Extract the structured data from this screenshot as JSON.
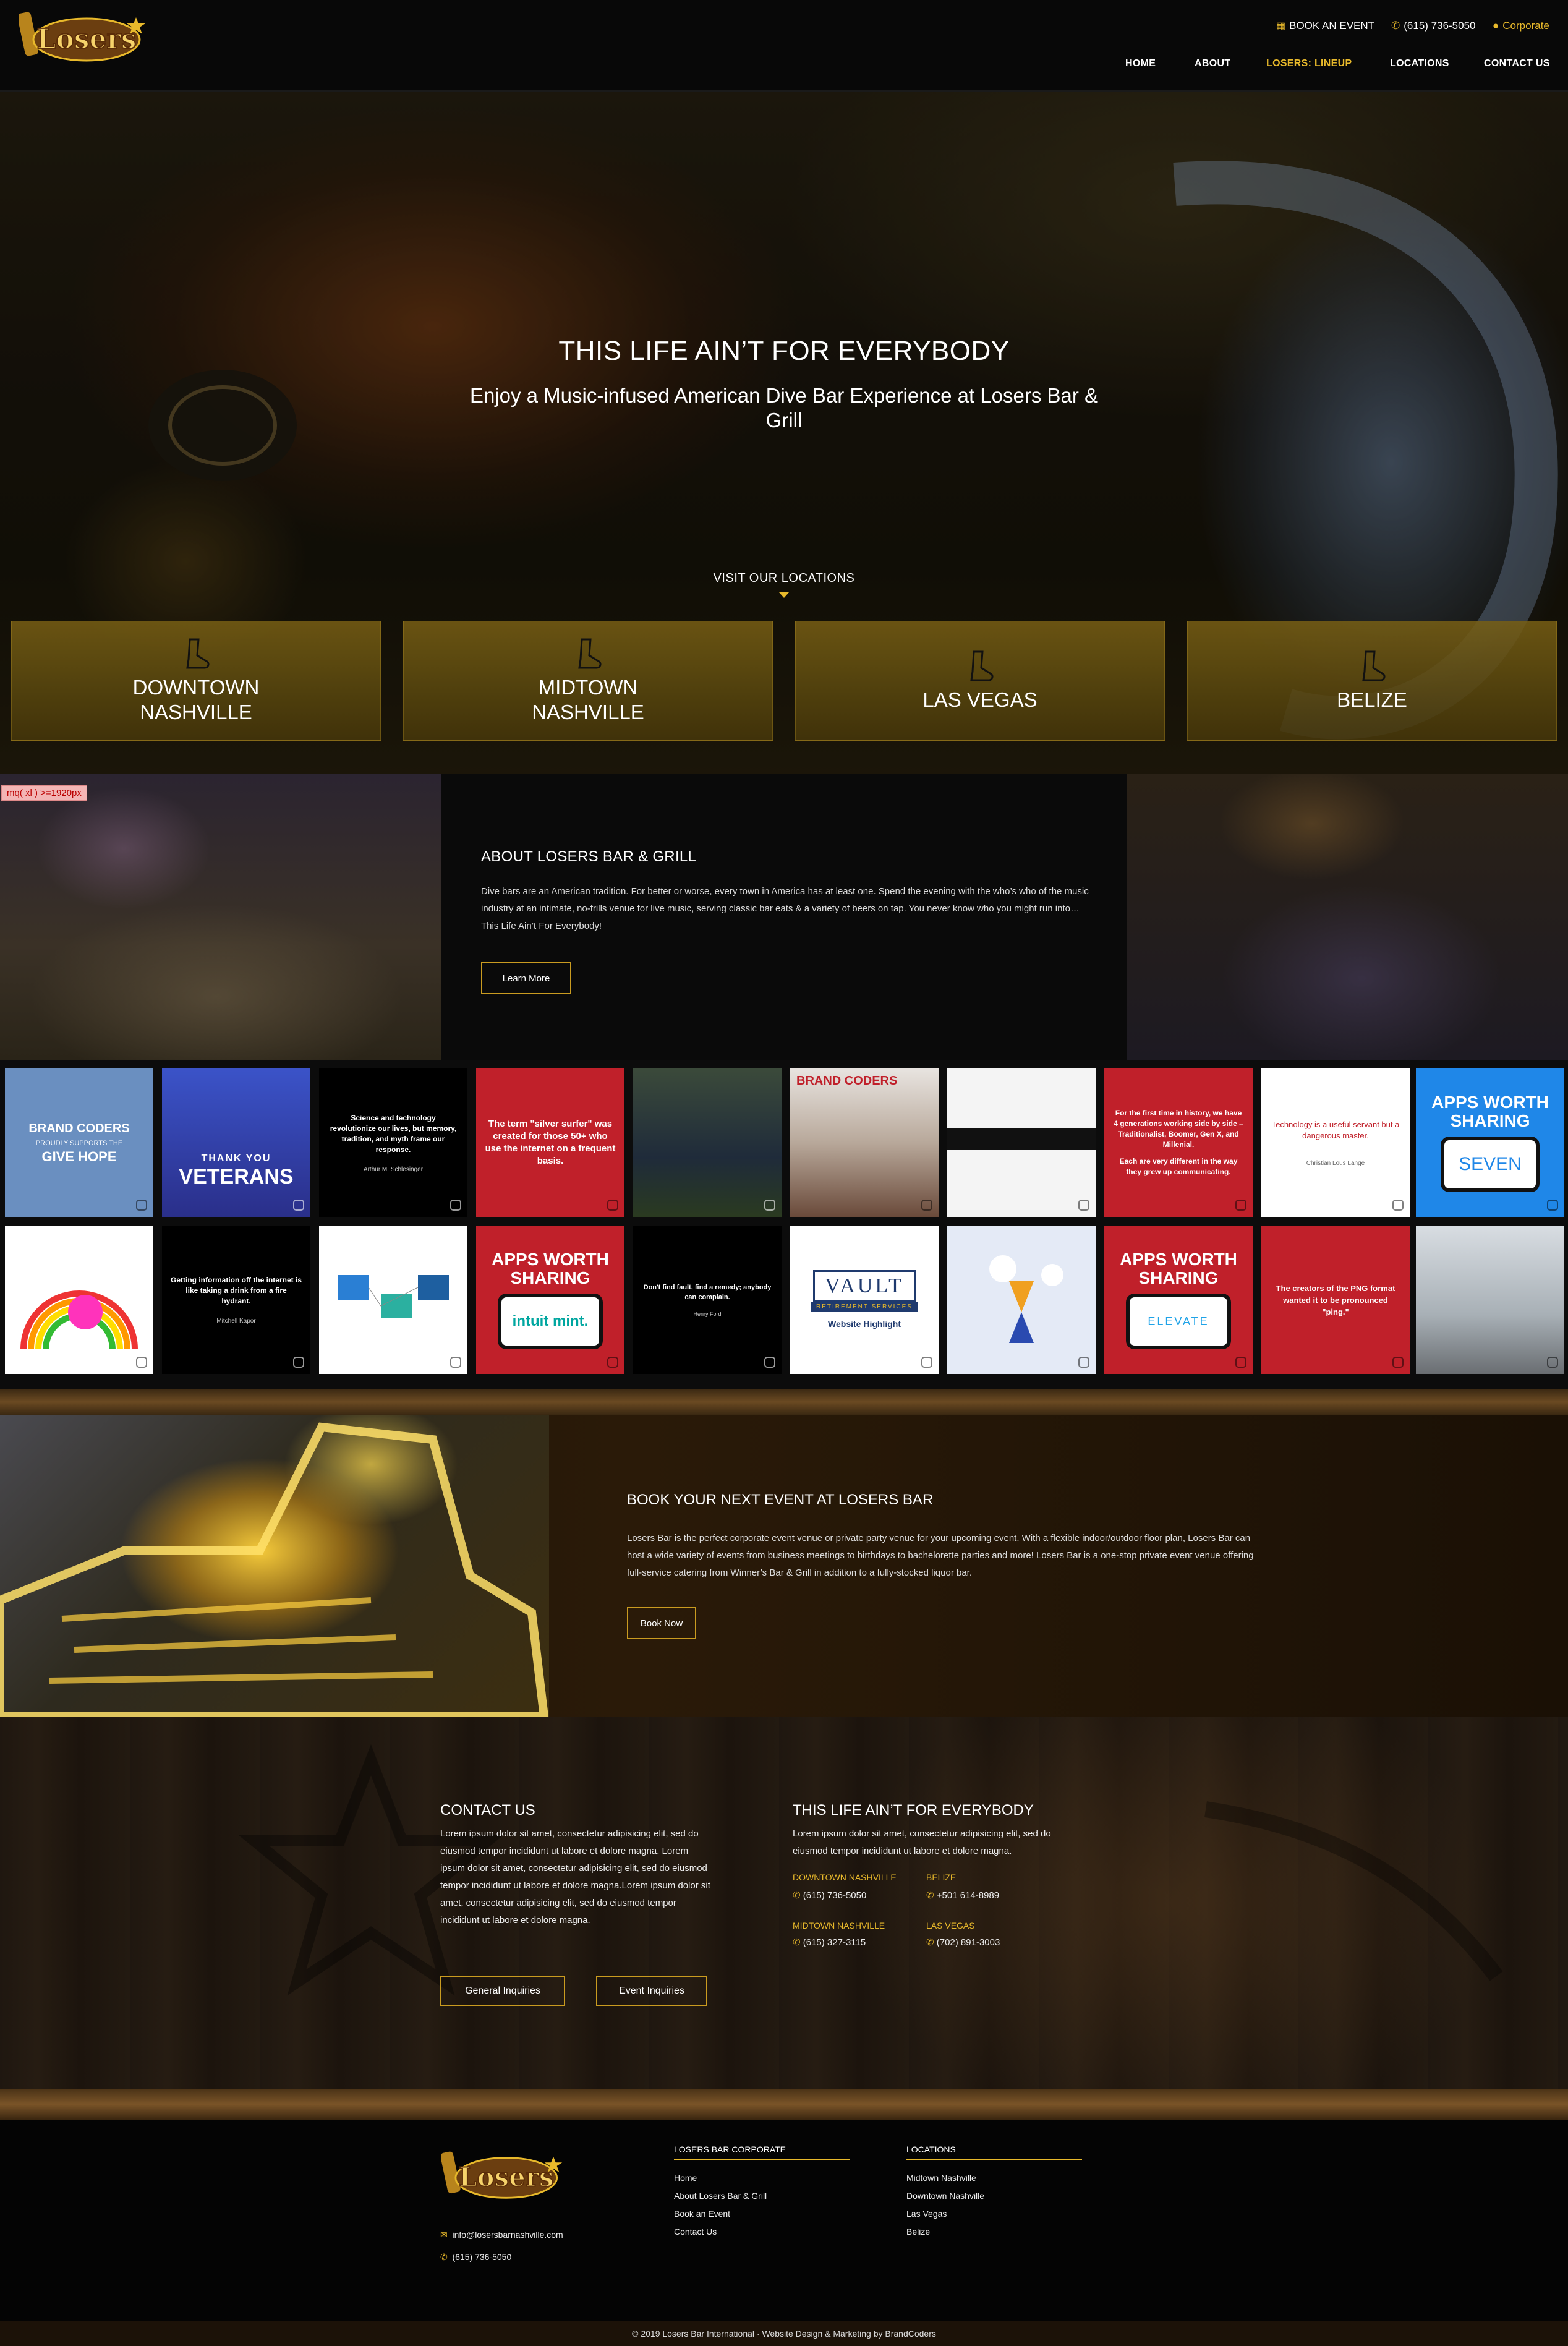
{
  "header": {
    "logo_text": "Losers",
    "book_event": "BOOK AN EVENT",
    "phone": "(615) 736-5050",
    "corporate": "Corporate",
    "nav": [
      "HOME",
      "ABOUT",
      "LOSERS: LINEUP",
      "LOCATIONS",
      "CONTACT US"
    ]
  },
  "hero": {
    "title": "THIS LIFE AIN’T FOR EVERYBODY",
    "subtitle": "Enjoy a Music-infused American Dive Bar Experience at Losers Bar & Grill",
    "visit": "VISIT OUR LOCATIONS",
    "locations": [
      "DOWNTOWN NASHVILLE",
      "MIDTOWN NASHVILLE",
      "LAS VEGAS",
      "BELIZE"
    ]
  },
  "about": {
    "debug_badge": "mq( xl ) >=1920px",
    "title": "ABOUT LOSERS BAR & GRILL",
    "body": "Dive bars are an American tradition. For better or worse, every town in America has at least one. Spend the evening with the who’s who of the music industry at an intimate, no-frills venue for live music, serving classic bar eats & a variety of beers on tap. You never know who you might run into… This Life Ain’t For Everybody!",
    "button": "Learn More"
  },
  "social": {
    "row1": [
      {
        "lines": [
          "BRAND CODERS",
          "PROUDLY SUPPORTS THE",
          "GIVE HOPE"
        ]
      },
      {
        "lines": [
          "THANK YOU",
          "VETERANS"
        ]
      },
      {
        "lines": [
          "Science and technology revolutionize our lives, but memory, tradition, and myth frame our response.",
          "Arthur M. Schlesinger"
        ]
      },
      {
        "lines": [
          "The term \"silver surfer\" was created for those 50+ who use the internet on a frequent basis."
        ]
      },
      {
        "lines": []
      },
      {
        "lines": [
          "BRAND CODERS"
        ]
      },
      {
        "lines": []
      },
      {
        "lines": [
          "For the first time in history, we have 4 generations working side by side – Traditionalist, Boomer, Gen X, and Millenial.",
          "Each are very different in the way they grew up communicating."
        ]
      },
      {
        "lines": [
          "Technology is a useful servant but a dangerous master.",
          "Christian Lous Lange"
        ]
      },
      {
        "lines": [
          "APPS WORTH SHARING",
          "SEVEN"
        ]
      }
    ],
    "row2": [
      {
        "lines": []
      },
      {
        "lines": [
          "Getting information off the internet is like taking a drink from a fire hydrant.",
          "Mitchell Kapor"
        ]
      },
      {
        "lines": []
      },
      {
        "lines": [
          "APPS WORTH SHARING",
          "intuit mint."
        ]
      },
      {
        "lines": [
          "Don't find fault, find a remedy; anybody can complain.",
          "Henry Ford"
        ]
      },
      {
        "lines": [
          "VAULT",
          "RETIREMENT SERVICES",
          "Website Highlight"
        ]
      },
      {
        "lines": []
      },
      {
        "lines": [
          "APPS WORTH SHARING",
          "ELEVATE"
        ]
      },
      {
        "lines": [
          "The creators of the PNG format wanted it to be pronounced \"ping.\""
        ]
      },
      {
        "lines": []
      }
    ]
  },
  "book": {
    "title": "BOOK YOUR NEXT EVENT AT LOSERS BAR",
    "body": "Losers Bar is the perfect corporate event venue or private party venue for your upcoming event. With a flexible indoor/outdoor floor plan, Losers Bar can host a wide variety of events from business meetings to birthdays to bachelorette parties and more! Losers Bar is a one-stop private event venue offering full-service catering from Winner’s Bar & Grill in addition to a fully-stocked liquor bar.",
    "button": "Book Now"
  },
  "contact": {
    "title": "CONTACT US",
    "body": "Lorem ipsum dolor sit amet, consectetur adipisicing elit, sed do eiusmod tempor incididunt ut labore et dolore magna. Lorem ipsum dolor sit amet, consectetur adipisicing elit, sed do eiusmod tempor incididunt ut labore et dolore magna.Lorem ipsum dolor sit amet, consectetur adipisicing elit, sed do eiusmod tempor incididunt ut labore et dolore magna.",
    "general_btn": "General Inquiries",
    "event_btn": "Event Inquiries",
    "right_title": "THIS LIFE AIN’T FOR EVERYBODY",
    "right_body": "Lorem ipsum dolor sit amet, consectetur adipisicing elit, sed do eiusmod tempor incididunt ut labore et dolore magna.",
    "locations": [
      {
        "name": "DOWNTOWN NASHVILLE",
        "phone": "(615) 736-5050"
      },
      {
        "name": "BELIZE",
        "phone": "+501 614-8989"
      },
      {
        "name": "MIDTOWN NASHVILLE",
        "phone": "(615) 327-3115"
      },
      {
        "name": "LAS VEGAS",
        "phone": "(702) 891-3003"
      }
    ]
  },
  "footer": {
    "email": "info@losersbarnashville.com",
    "phone": "(615) 736-5050",
    "corporate_head": "LOSERS BAR CORPORATE",
    "corporate_links": [
      "Home",
      "About Losers Bar & Grill",
      "Book an Event",
      "Contact Us"
    ],
    "locations_head": "LOCATIONS",
    "location_links": [
      "Midtown Nashville",
      "Downtown Nashville",
      "Las Vegas",
      "Belize"
    ],
    "copyright": "© 2019 Losers Bar International · Website Design & Marketing by BrandCoders"
  },
  "colors": {
    "accent": "#e8b92b",
    "background": "#000000",
    "brown": "#1e160f"
  }
}
